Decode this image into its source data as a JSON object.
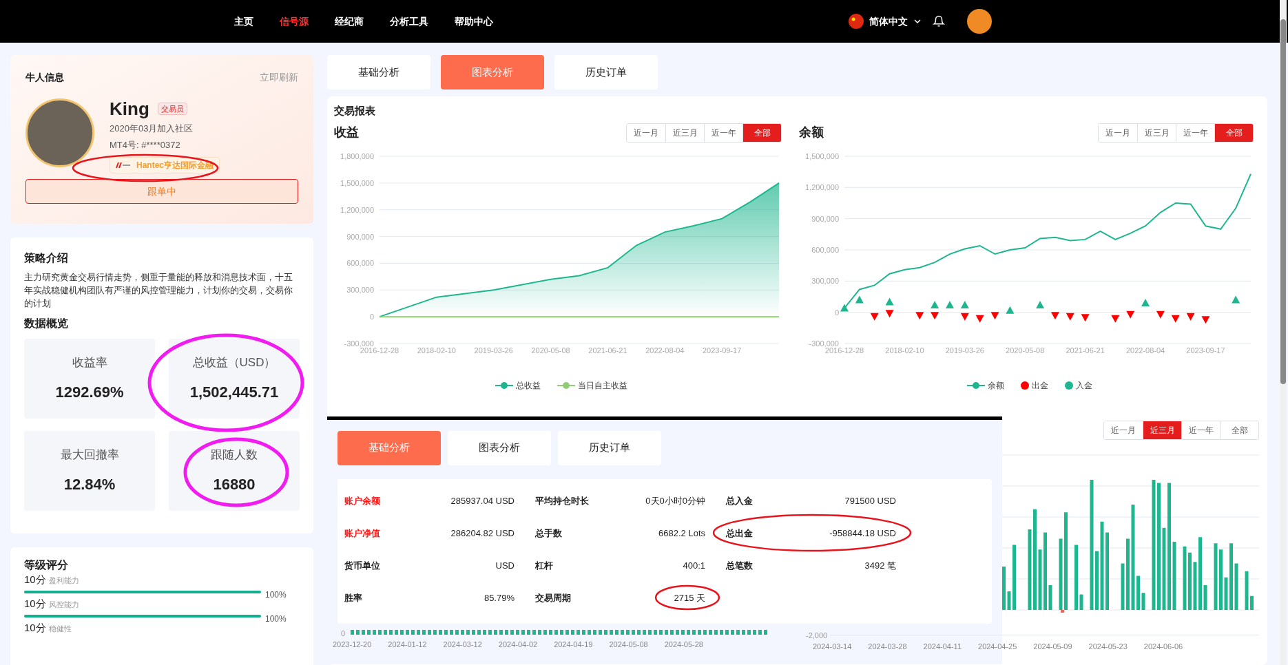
{
  "nav": {
    "items": [
      {
        "label": "主页",
        "selected": false
      },
      {
        "label": "信号源",
        "selected": true
      },
      {
        "label": "经纪商",
        "selected": false
      },
      {
        "label": "分析工具",
        "selected": false
      },
      {
        "label": "帮助中心",
        "selected": false
      }
    ],
    "language": "简体中文"
  },
  "profile": {
    "title": "牛人信息",
    "refresh": "立即刷新",
    "name": "King",
    "badge": "交易员",
    "joined": "2020年03月加入社区",
    "account": "MT4号: #****0372",
    "broker": "Hantec亨达国际金融",
    "follow_button": "跟单中"
  },
  "strategy": {
    "title": "策略介绍",
    "text": "主力研究黄金交易行情走势，侧重于量能的释放和消息技术面，十五年实战稳健机构团队有严谨的风控管理能力，计划你的交易，交易你的计划",
    "overview_title": "数据概览",
    "stats": [
      {
        "label": "收益率",
        "value": "1292.69%"
      },
      {
        "label": "总收益（USD）",
        "value": "1,502,445.71"
      },
      {
        "label": "最大回撤率",
        "value": "12.84%"
      },
      {
        "label": "跟随人数",
        "value": "16880"
      }
    ]
  },
  "rating": {
    "title": "等级评分",
    "items": [
      {
        "score": "10分",
        "label": "盈利能力",
        "level": 1,
        "reading": "100%"
      },
      {
        "score": "10分",
        "label": "风控能力",
        "level": 1,
        "reading": "100%"
      },
      {
        "score": "10分",
        "label": "稳健性"
      }
    ]
  },
  "tabs": [
    {
      "label": "基础分析",
      "selected": false
    },
    {
      "label": "图表分析",
      "selected": true
    },
    {
      "label": "历史订单",
      "selected": false
    }
  ],
  "report": {
    "title": "交易报表",
    "charts": [
      {
        "title": "收益",
        "ranges": [
          {
            "label": "近一月",
            "selected": false
          },
          {
            "label": "近三月",
            "selected": false
          },
          {
            "label": "近一年",
            "selected": false
          },
          {
            "label": "全部",
            "selected": true
          }
        ],
        "chart_data": {
          "type": "line",
          "grid": true,
          "categories": [
            "2016-12-28",
            null,
            "2018-02-10",
            null,
            "2019-03-26",
            null,
            "2020-05-08",
            null,
            "2021-06-21",
            null,
            "2022-08-04",
            null,
            "2023-09-17",
            null,
            null
          ],
          "ylim": [
            -300000,
            1800000
          ],
          "yticks": [
            {
              "value": -300000,
              "label": "-300,000"
            },
            {
              "value": 0,
              "label": "0"
            },
            {
              "value": 300000,
              "label": "300,000"
            },
            {
              "value": 600000,
              "label": "600,000"
            },
            {
              "value": 900000,
              "label": "900,000"
            },
            {
              "value": 1200000,
              "label": "1,200,000"
            },
            {
              "value": 1500000,
              "label": "1,500,000"
            },
            {
              "value": 1800000,
              "label": "1,800,000"
            }
          ],
          "series": [
            {
              "name": "总收益",
              "color": "#1db68e",
              "type": "area",
              "values": [
                0,
                110000,
                220000,
                260000,
                300000,
                360000,
                420000,
                460000,
                550000,
                800000,
                950000,
                1020000,
                1100000,
                1290000,
                1500000
              ]
            },
            {
              "name": "当日自主收益",
              "color": "#91cc75",
              "type": "line",
              "values": [
                0,
                0,
                0,
                0,
                0,
                0,
                0,
                0,
                0,
                0,
                0,
                0,
                0,
                0,
                0
              ]
            }
          ]
        }
      },
      {
        "title": "余额",
        "ranges": [
          {
            "label": "近一月",
            "selected": false
          },
          {
            "label": "近三月",
            "selected": false
          },
          {
            "label": "近一年",
            "selected": false
          },
          {
            "label": "全部",
            "selected": true
          }
        ],
        "chart_data": {
          "type": "line",
          "grid": true,
          "categories": [
            "2016-12-28",
            null,
            null,
            null,
            "2018-02-10",
            null,
            null,
            null,
            "2019-03-26",
            null,
            null,
            null,
            "2020-05-08",
            null,
            null,
            null,
            "2021-06-21",
            null,
            null,
            null,
            "2022-08-04",
            null,
            null,
            null,
            "2023-09-17",
            null,
            null,
            null
          ],
          "ylim": [
            -300000,
            1500000
          ],
          "yticks": [
            {
              "value": -300000,
              "label": "-300,000"
            },
            {
              "value": 0,
              "label": "0"
            },
            {
              "value": 300000,
              "label": "300,000"
            },
            {
              "value": 600000,
              "label": "600,000"
            },
            {
              "value": 900000,
              "label": "900,000"
            },
            {
              "value": 1200000,
              "label": "1,200,000"
            },
            {
              "value": 1500000,
              "label": "1,500,000"
            }
          ],
          "series": [
            {
              "name": "余额",
              "color": "#1db68e",
              "type": "line",
              "values": [
                40000,
                220000,
                260000,
                370000,
                410000,
                430000,
                480000,
                560000,
                610000,
                640000,
                560000,
                600000,
                620000,
                710000,
                720000,
                690000,
                700000,
                780000,
                700000,
                760000,
                830000,
                960000,
                1050000,
                1040000,
                830000,
                800000,
                1000000,
                1330000
              ]
            },
            {
              "name": "出金",
              "color": "#ff0000",
              "type": "scatter",
              "values": [
                null,
                null,
                -40000,
                -10000,
                null,
                -30000,
                -30000,
                null,
                -40000,
                -60000,
                -30000,
                null,
                null,
                null,
                -30000,
                -40000,
                -50000,
                null,
                -60000,
                -20000,
                null,
                -20000,
                -60000,
                -40000,
                -70000,
                null,
                null,
                null
              ]
            },
            {
              "name": "入金",
              "color": "#1db68e",
              "type": "scatter",
              "values": [
                40000,
                120000,
                null,
                100000,
                null,
                null,
                70000,
                70000,
                70000,
                null,
                null,
                20000,
                null,
                70000,
                null,
                null,
                null,
                null,
                null,
                null,
                90000,
                null,
                null,
                null,
                null,
                null,
                120000,
                null
              ]
            }
          ]
        }
      }
    ]
  },
  "bar_chart": {
    "ranges": [
      {
        "label": "近一月",
        "selected": false
      },
      {
        "label": "近三月",
        "selected": true
      },
      {
        "label": "近一年",
        "selected": false
      },
      {
        "label": "全部",
        "selected": false
      }
    ],
    "ytick": "-2,000",
    "x_labels": [
      "2024-03-14",
      "2024-03-28",
      "2024-04-11",
      "2024-04-25",
      "2024-05-09",
      "2024-05-23",
      "2024-06-06"
    ]
  },
  "overlay": {
    "tabs": [
      {
        "label": "基础分析",
        "selected": true
      },
      {
        "label": "图表分析",
        "selected": false
      },
      {
        "label": "历史订单",
        "selected": false
      }
    ],
    "columns": [
      [
        {
          "label": "账户余额",
          "value": "285937.04 USD",
          "highlight": true
        },
        {
          "label": "账户净值",
          "value": "286204.82 USD",
          "highlight": true
        },
        {
          "label": "货币单位",
          "value": "USD",
          "highlight": false
        },
        {
          "label": "胜率",
          "value": "85.79%",
          "highlight": false
        }
      ],
      [
        {
          "label": "平均持仓时长",
          "value": "0天0小时0分钟",
          "highlight": false
        },
        {
          "label": "总手数",
          "value": "6682.2 Lots",
          "highlight": false
        },
        {
          "label": "杠杆",
          "value": "400:1",
          "highlight": false
        },
        {
          "label": "交易周期",
          "value": "2715 天",
          "highlight": false
        }
      ],
      [
        {
          "label": "总入金",
          "value": "791500 USD",
          "highlight": false
        },
        {
          "label": "总出金",
          "value": "-958844.18 USD",
          "highlight": false
        },
        {
          "label": "总笔数",
          "value": "3492 笔",
          "highlight": false
        }
      ]
    ],
    "strip": {
      "ytick": "0",
      "x_labels": [
        "2023-12-20",
        "2024-01-12",
        "2024-03-12",
        "2024-04-02",
        "2024-04-19",
        "2024-05-08",
        "2024-05-28"
      ]
    }
  }
}
